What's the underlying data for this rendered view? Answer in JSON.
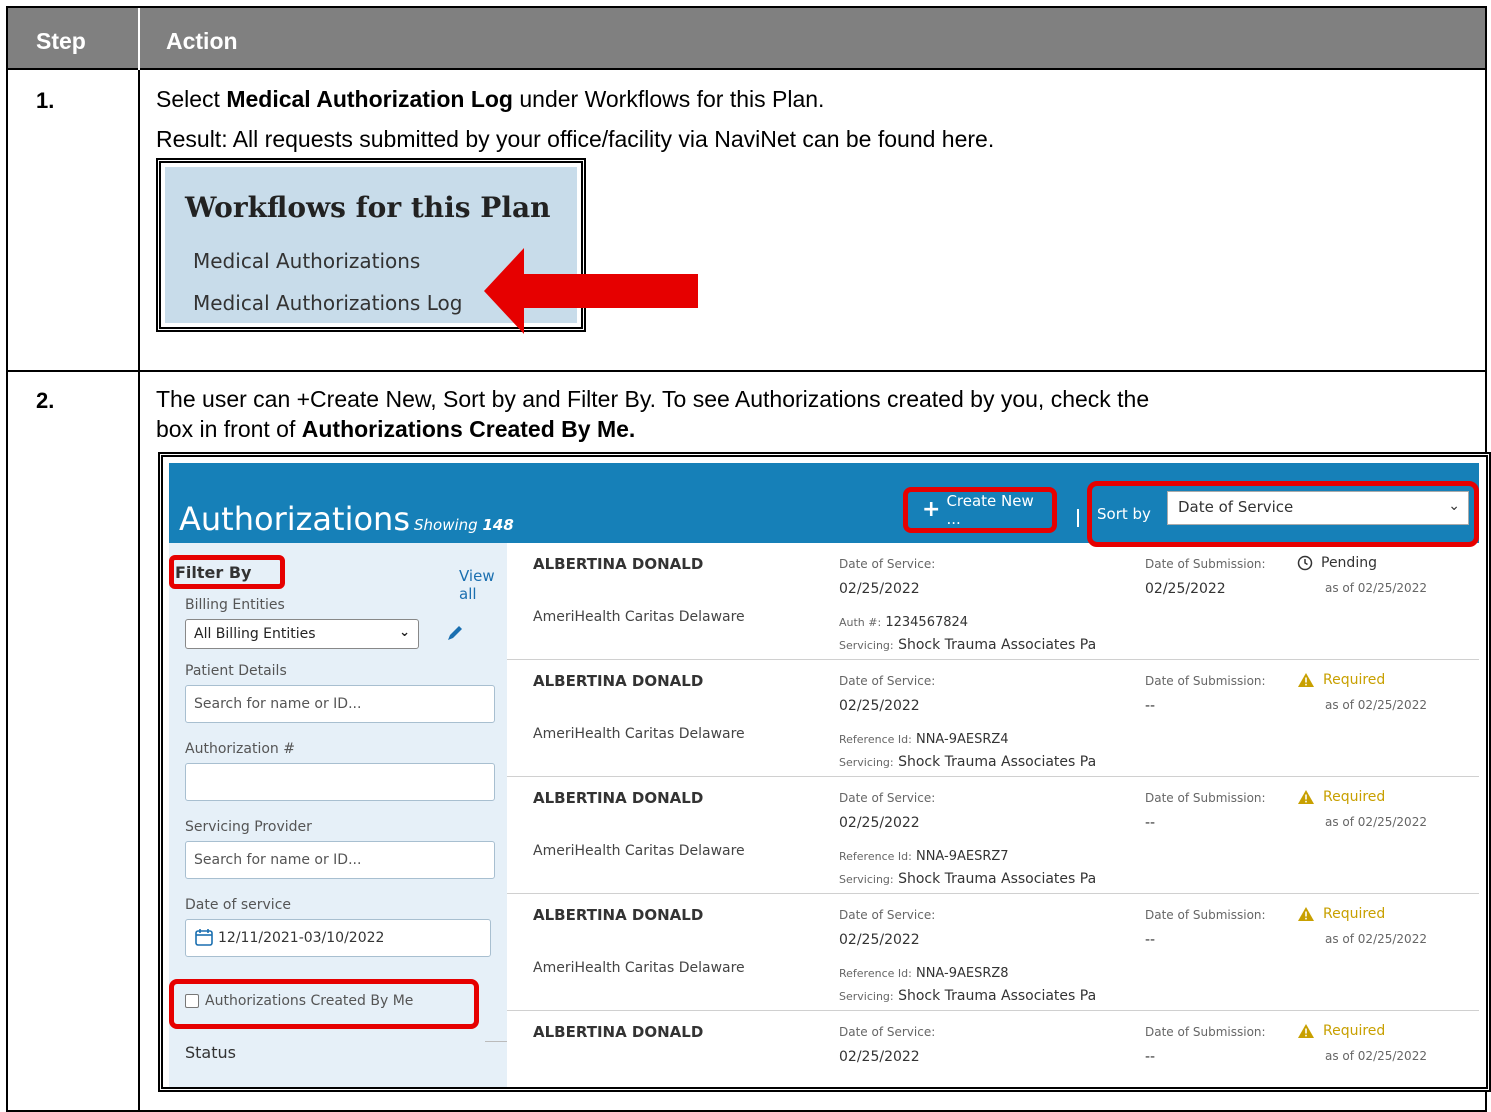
{
  "table": {
    "header_step": "Step",
    "header_action": "Action"
  },
  "step1": {
    "number": "1.",
    "line1_pre": "Select ",
    "line1_bold": "Medical Authorization Log",
    "line1_post": " under Workflows for this Plan.",
    "line2": "Result: All requests submitted by your office/facility via NaviNet can be found here.",
    "workflows": {
      "title": "Workflows for this Plan",
      "items": [
        "Medical Authorizations",
        "Medical Authorizations Log"
      ]
    }
  },
  "step2": {
    "number": "2.",
    "line1": "The user can +Create New, Sort by and Filter By. To see Authorizations created by you, check the",
    "line2_pre": "box in front of ",
    "line2_bold": "Authorizations Created By Me."
  },
  "auth_ui": {
    "title": "Authorizations",
    "showing_label": "Showing",
    "showing_count": "148",
    "create_new": "Create New ...",
    "sort_by_label": "Sort by",
    "sort_by_value": "Date of Service",
    "filter": {
      "title": "Filter By",
      "view_all": "View all",
      "billing_label": "Billing Entities",
      "billing_value": "All Billing Entities",
      "patient_label": "Patient Details",
      "patient_placeholder": "Search for name or ID...",
      "auth_label": "Authorization #",
      "servicing_label": "Servicing Provider",
      "servicing_placeholder": "Search for name or ID...",
      "dos_label": "Date of service",
      "dos_value": "12/11/2021-03/10/2022",
      "created_by_me": "Authorizations Created By Me",
      "status_label": "Status"
    },
    "rows": [
      {
        "name": "ALBERTINA DONALD",
        "plan": "AmeriHealth Caritas Delaware",
        "dos_label": "Date of Service:",
        "dos": "02/25/2022",
        "id_label": "Auth #:",
        "id": "1234567824",
        "srv_label": "Servicing:",
        "srv": "Shock Trauma Associates Pa",
        "dsub_label": "Date of Submission:",
        "dsub": "02/25/2022",
        "status": "Pending",
        "asof": "as of 02/25/2022"
      },
      {
        "name": "ALBERTINA DONALD",
        "plan": "AmeriHealth Caritas Delaware",
        "dos_label": "Date of Service:",
        "dos": "02/25/2022",
        "id_label": "Reference Id:",
        "id": "NNA-9AESRZ4",
        "srv_label": "Servicing:",
        "srv": "Shock Trauma Associates Pa",
        "dsub_label": "Date of Submission:",
        "dsub": "--",
        "status": "Required",
        "asof": "as of 02/25/2022"
      },
      {
        "name": "ALBERTINA DONALD",
        "plan": "AmeriHealth Caritas Delaware",
        "dos_label": "Date of Service:",
        "dos": "02/25/2022",
        "id_label": "Reference Id:",
        "id": "NNA-9AESRZ7",
        "srv_label": "Servicing:",
        "srv": "Shock Trauma Associates Pa",
        "dsub_label": "Date of Submission:",
        "dsub": "--",
        "status": "Required",
        "asof": "as of 02/25/2022"
      },
      {
        "name": "ALBERTINA DONALD",
        "plan": "AmeriHealth Caritas Delaware",
        "dos_label": "Date of Service:",
        "dos": "02/25/2022",
        "id_label": "Reference Id:",
        "id": "NNA-9AESRZ8",
        "srv_label": "Servicing:",
        "srv": "Shock Trauma Associates Pa",
        "dsub_label": "Date of Submission:",
        "dsub": "--",
        "status": "Required",
        "asof": "as of 02/25/2022"
      },
      {
        "name": "ALBERTINA DONALD",
        "plan": "",
        "dos_label": "Date of Service:",
        "dos": "02/25/2022",
        "id_label": "",
        "id": "",
        "srv_label": "",
        "srv": "",
        "dsub_label": "Date of Submission:",
        "dsub": "--",
        "status": "Required",
        "asof": "as of 02/25/2022"
      }
    ],
    "colors": {
      "header_blue": "#1680b8",
      "highlight_red": "#e60000",
      "warning_gold": "#c8a000",
      "sidebar_bg": "#e6f0f8"
    }
  }
}
